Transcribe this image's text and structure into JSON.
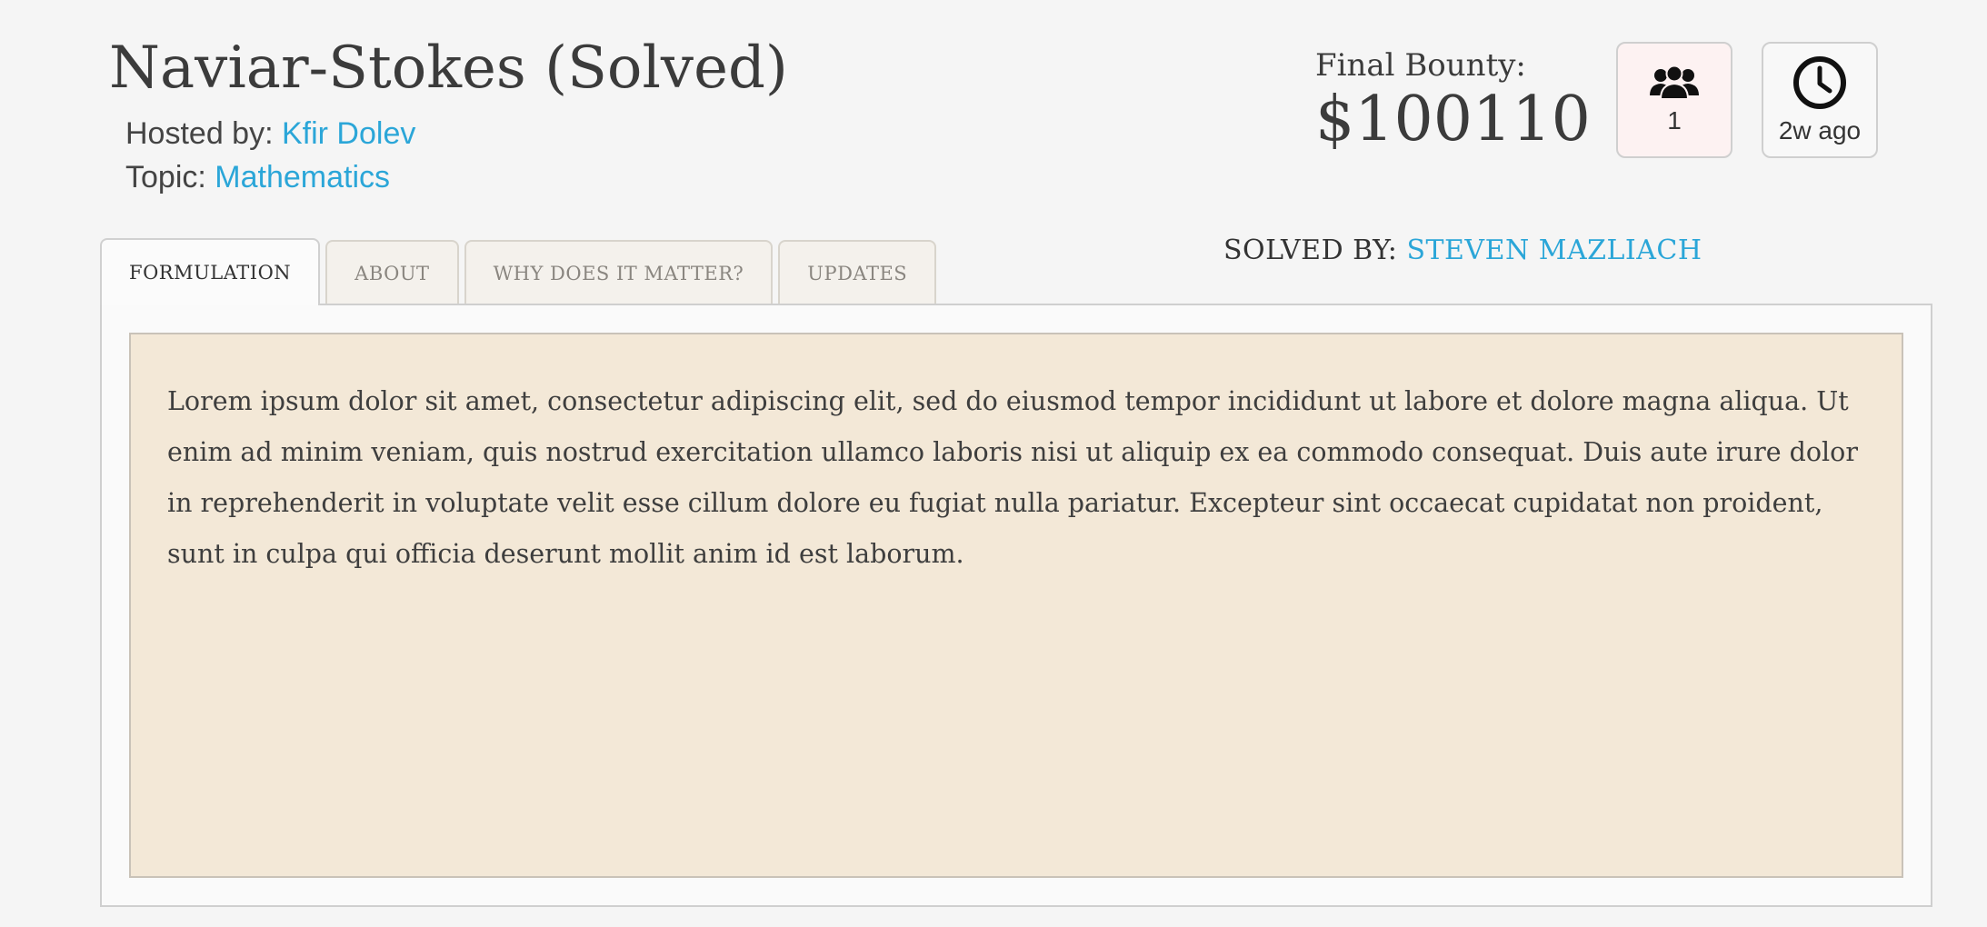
{
  "header": {
    "title": "Naviar-Stokes (Solved)",
    "hosted_by_label": "Hosted by:",
    "host_name": "Kfir Dolev",
    "topic_label": "Topic:",
    "topic_name": "Mathematics"
  },
  "bounty": {
    "label": "Final Bounty:",
    "value": "$100110"
  },
  "stats": {
    "participants_icon": "people-icon",
    "participants": "1",
    "time_icon": "clock-icon",
    "time_ago": "2w ago"
  },
  "solved": {
    "label": "SOLVED BY:",
    "name": "STEVEN MAZLIACH"
  },
  "tabs": [
    {
      "label": "FORMULATION",
      "active": true
    },
    {
      "label": "ABOUT",
      "active": false
    },
    {
      "label": "WHY DOES IT MATTER?",
      "active": false
    },
    {
      "label": "UPDATES",
      "active": false
    }
  ],
  "content": {
    "text": "Lorem ipsum dolor sit amet, consectetur adipiscing elit, sed do eiusmod tempor incididunt ut labore et dolore magna aliqua. Ut enim ad minim veniam, quis nostrud exercitation ullamco laboris nisi ut aliquip ex ea commodo consequat. Duis aute irure dolor in reprehenderit in voluptate velit esse cillum dolore eu fugiat nulla pariatur. Excepteur sint occaecat cupidatat non proident, sunt in culpa qui officia deserunt mollit anim id est laborum."
  },
  "colors": {
    "link": "#2ba6d8",
    "content_background": "#f3e8d7",
    "page_background": "#f5f5f5"
  }
}
